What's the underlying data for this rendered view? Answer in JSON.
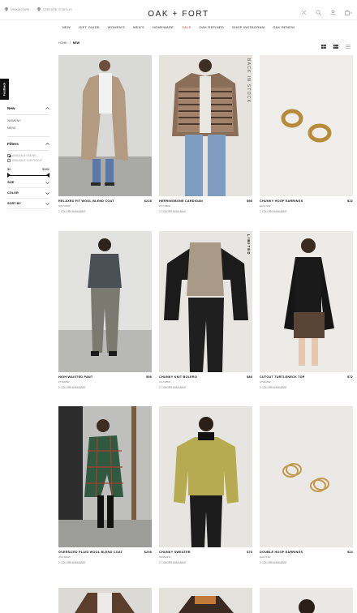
{
  "topbar": {
    "location_1": "UNKNOWN",
    "location_2": "CREATE STATUS",
    "logo": "OAK + FORT",
    "cart_count": "0"
  },
  "nav": {
    "items": [
      "NEW",
      "GIFT GUIDE",
      "WOMEN'S",
      "MEN'S",
      "HOMEWARE",
      "SALE",
      "OAK REFINED",
      "SHOP INSTAGRAM",
      "OAK RENEW"
    ]
  },
  "breadcrumb": {
    "home": "HOME",
    "separator": "/",
    "current": "NEW"
  },
  "feedback": {
    "label": "Feedback"
  },
  "sidebar": {
    "new_heading": "New",
    "categories": [
      "WOMENS",
      "MENS"
    ],
    "filters_heading": "Filters",
    "availability": [
      {
        "label": "AVAILABLE ONLINE",
        "checked": true
      },
      {
        "label": "AVAILABLE FOR PICKUP",
        "checked": false
      }
    ],
    "price_min": "$0",
    "price_max": "$280",
    "rows": [
      "SIZE",
      "COLOR",
      "SORT BY"
    ]
  },
  "products": [
    {
      "name": "RELAXED FIT WOOL BLEND COAT",
      "price": "$228",
      "code": "OW7783W",
      "colors": "2 COLORS AVAILABLE",
      "badge": ""
    },
    {
      "name": "HERRINGBONE CARDIGAN",
      "price": "$98",
      "code": "CG7495W",
      "colors": "2 COLORS AVAILABLE",
      "badge": "BACK IN STOCK"
    },
    {
      "name": "CHUNKY HOOP EARRINGS",
      "price": "$22",
      "code": "EA1372W",
      "colors": "2 COLORS AVAILABLE",
      "badge": ""
    },
    {
      "name": "HIGH WAISTED PANT",
      "price": "$98",
      "code": "PT9483W",
      "colors": "2 COLORS AVAILABLE",
      "badge": ""
    },
    {
      "name": "CHUNKY KNIT BOLERO",
      "price": "$88",
      "code": "CG7435W",
      "colors": "2 COLORS AVAILABLE",
      "badge": "LIMITED"
    },
    {
      "name": "CUTOUT TURTLENECK TOP",
      "price": "$72",
      "code": "KT9936W",
      "colors": "2 COLORS AVAILABLE",
      "badge": ""
    },
    {
      "name": "OVERSIZED PLAID WOOL BLEND COAT",
      "price": "$298",
      "code": "OW7935W",
      "colors": "2 COLORS AVAILABLE",
      "badge": ""
    },
    {
      "name": "CHUNKY SWEATER",
      "price": "$78",
      "code": "SW3941W",
      "colors": "2 COLORS AVAILABLE",
      "badge": ""
    },
    {
      "name": "DOUBLE HOOP EARRINGS",
      "price": "$24",
      "code": "EA1373W",
      "colors": "2 COLORS AVAILABLE",
      "badge": ""
    }
  ],
  "colors": {
    "sale": "#c0392b",
    "text": "#1a1a1a",
    "feedback_bg": "#111111"
  }
}
